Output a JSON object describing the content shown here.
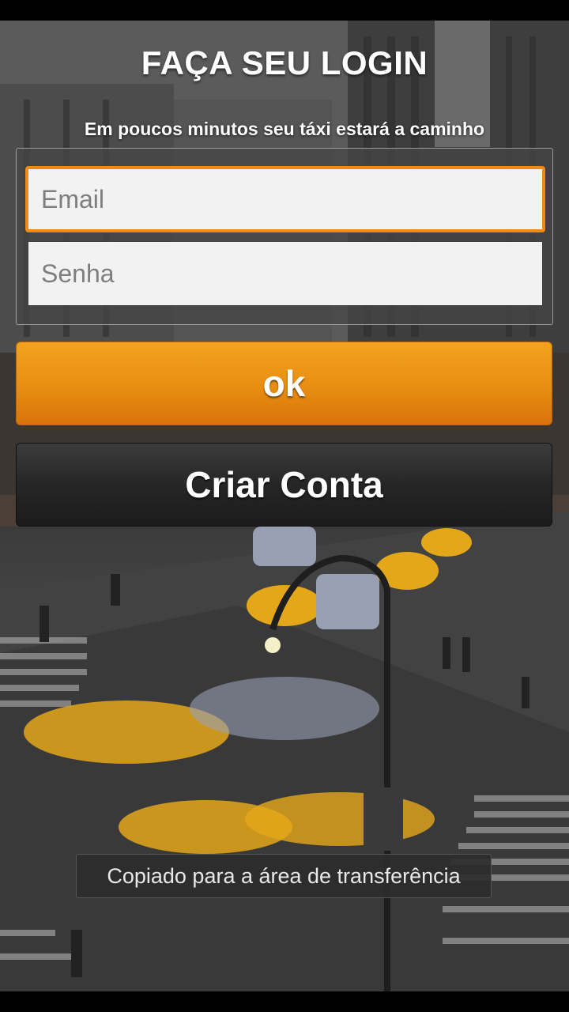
{
  "login": {
    "title": "FAÇA SEU LOGIN",
    "subtitle": "Em poucos minutos seu táxi estará a caminho",
    "email_placeholder": "Email",
    "password_placeholder": "Senha",
    "ok_label": "ok",
    "create_account_label": "Criar Conta"
  },
  "toast": {
    "message": "Copiado para a área de transferência"
  },
  "colors": {
    "accent": "#f08a14",
    "ok_button": "#e88e12",
    "create_button": "#262626"
  }
}
